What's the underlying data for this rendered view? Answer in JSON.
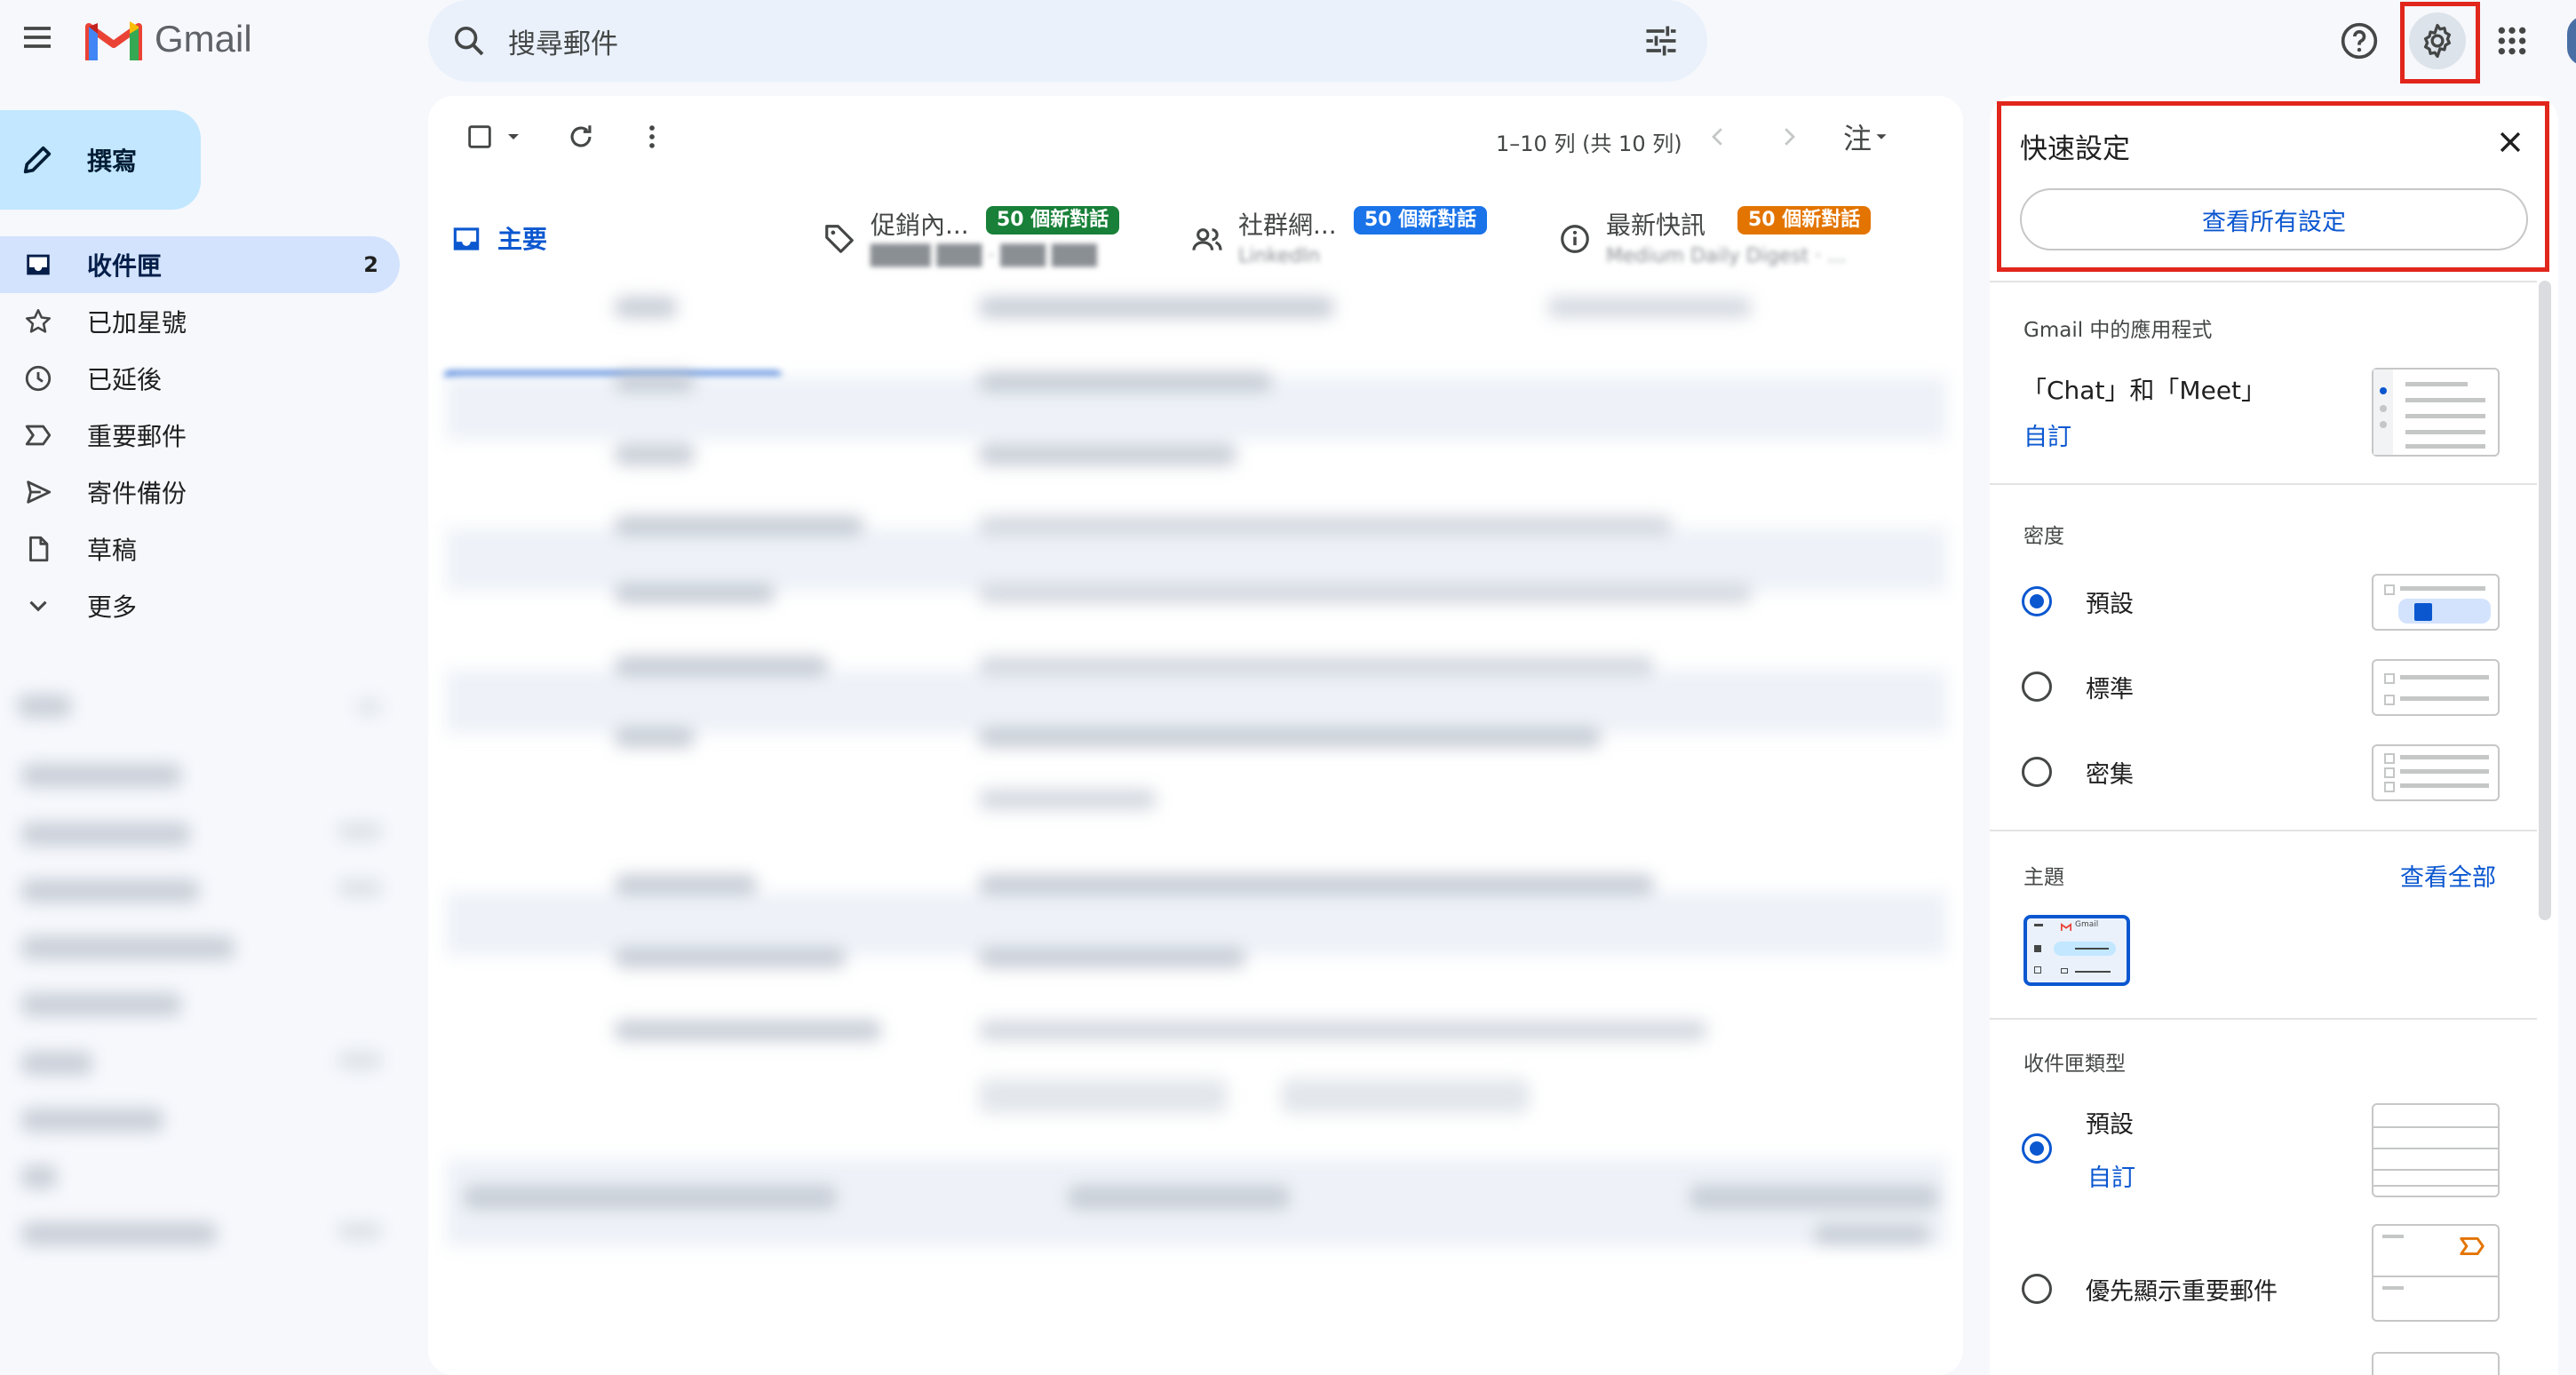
{
  "app": {
    "name": "Gmail"
  },
  "search": {
    "placeholder": "搜尋郵件"
  },
  "compose": {
    "label": "撰寫"
  },
  "nav": {
    "items": [
      {
        "label": "收件匣",
        "count": "2",
        "icon": "inbox-icon"
      },
      {
        "label": "已加星號",
        "icon": "star-icon"
      },
      {
        "label": "已延後",
        "icon": "clock-icon"
      },
      {
        "label": "重要郵件",
        "icon": "important-icon"
      },
      {
        "label": "寄件備份",
        "icon": "send-icon"
      },
      {
        "label": "草稿",
        "icon": "draft-icon"
      },
      {
        "label": "更多",
        "icon": "chevron-down-icon"
      }
    ]
  },
  "toolbar": {
    "pager": "1–10 列 (共 10 列)",
    "lang_indicator": "注"
  },
  "tabs": [
    {
      "label": "主要",
      "icon": "inbox-icon"
    },
    {
      "label": "促銷內...",
      "badge": "50 個新對話",
      "badge_color": "#188038"
    },
    {
      "label": "社群網...",
      "badge": "50 個新對話",
      "badge_color": "#1a73e8",
      "sub": "LinkedIn"
    },
    {
      "label": "最新快訊",
      "badge": "50 個新對話",
      "badge_color": "#e37400",
      "sub": "Medium Daily Digest · ..."
    }
  ],
  "quick_settings": {
    "title": "快速設定",
    "see_all_button": "查看所有設定",
    "apps_section": {
      "heading": "Gmail 中的應用程式",
      "text": "「Chat」和「Meet」",
      "customize": "自訂"
    },
    "density": {
      "heading": "密度",
      "options": [
        {
          "label": "預設",
          "selected": true
        },
        {
          "label": "標準",
          "selected": false
        },
        {
          "label": "密集",
          "selected": false
        }
      ]
    },
    "theme": {
      "heading": "主題",
      "see_all": "查看全部",
      "thumb_text": "Gmail"
    },
    "inbox_type": {
      "heading": "收件匣類型",
      "options": [
        {
          "label": "預設",
          "selected": true,
          "customize": "自訂"
        },
        {
          "label": "優先顯示重要郵件",
          "selected": false
        }
      ]
    }
  },
  "colors": {
    "accent": "#0b57d0",
    "highlight_box": "#e1261c",
    "nav_active": "#d3e3fd",
    "compose_bg": "#c2e7ff",
    "app_bg": "#f6f8fc"
  }
}
